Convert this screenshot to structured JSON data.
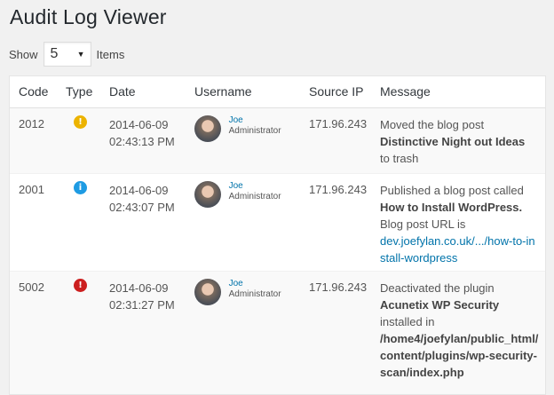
{
  "page": {
    "title": "Audit Log Viewer"
  },
  "pager": {
    "show_label": "Show",
    "per_page": "5",
    "items_label": "Items"
  },
  "columns": [
    "Code",
    "Type",
    "Date",
    "Username",
    "Source IP",
    "Message"
  ],
  "colors": {
    "warning": "#ecb300",
    "info": "#1e9be3",
    "critical": "#cc1f1f",
    "link": "#0073aa"
  },
  "rows": [
    {
      "code": "2012",
      "type": "warning",
      "type_glyph": "!",
      "date": "2014-06-09",
      "time": "02:43:13 PM",
      "user": "Joe",
      "role": "Administrator",
      "ip": "171.96.243",
      "message": [
        "Moved the blog post",
        "Distinctive Night out Ideas",
        "to trash"
      ]
    },
    {
      "code": "2001",
      "type": "info",
      "type_glyph": "i",
      "date": "2014-06-09",
      "time": "02:43:07 PM",
      "user": "Joe",
      "role": "Administrator",
      "ip": "171.96.243",
      "message": [
        "Published a blog post called",
        "How to Install WordPress.",
        "Blog post URL is",
        "dev.joefylan.co.uk/.../how-to-install-wordpress"
      ]
    },
    {
      "code": "5002",
      "type": "critical",
      "type_glyph": "!",
      "date": "2014-06-09",
      "time": "02:31:27 PM",
      "user": "Joe",
      "role": "Administrator",
      "ip": "171.96.243",
      "message": [
        "Deactivated the plugin",
        "Acunetix WP Security",
        "installed in",
        "/home4/joefylan/public_html/content/plugins/wp-security-scan/index.php"
      ]
    }
  ]
}
